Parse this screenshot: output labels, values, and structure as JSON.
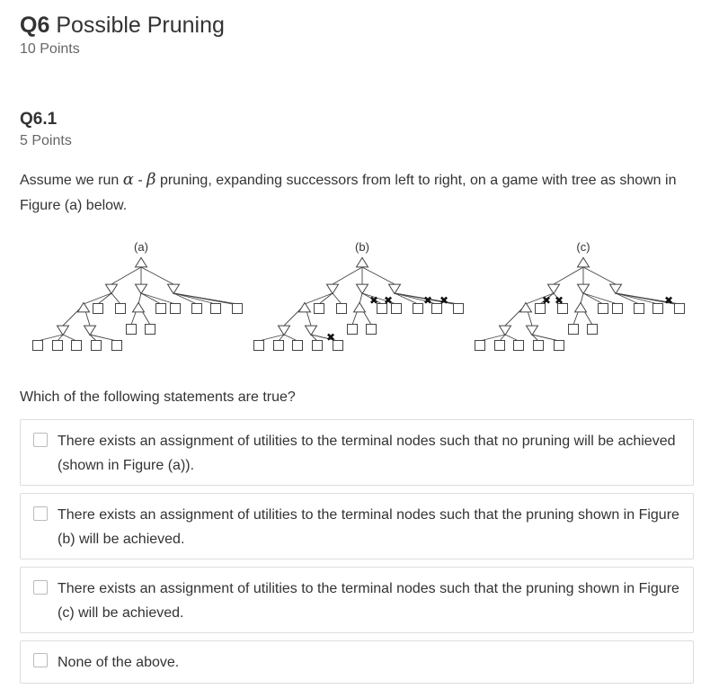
{
  "question": {
    "number": "Q6",
    "title": "Possible Pruning",
    "points": "10 Points"
  },
  "subquestion": {
    "number": "Q6.1",
    "points": "5 Points",
    "prompt_before": "Assume we run",
    "alpha": "α",
    "dash": " - ",
    "beta": "β",
    "prompt_after": " pruning, expanding successors from left to right, on a game with tree as shown in Figure (a) below.",
    "figure_labels": [
      "(a)",
      "(b)",
      "(c)"
    ],
    "which": "Which of the following statements are true?",
    "options": [
      {
        "label": "There exists an assignment of utilities to the terminal nodes such that no pruning will be achieved (shown in Figure (a))."
      },
      {
        "label": "There exists an assignment of utilities to the terminal nodes such that the pruning shown in Figure (b) will be achieved."
      },
      {
        "label": "There exists an assignment of utilities to the terminal nodes such that the pruning shown in Figure (c) will be achieved."
      },
      {
        "label": "None of the above."
      }
    ]
  }
}
